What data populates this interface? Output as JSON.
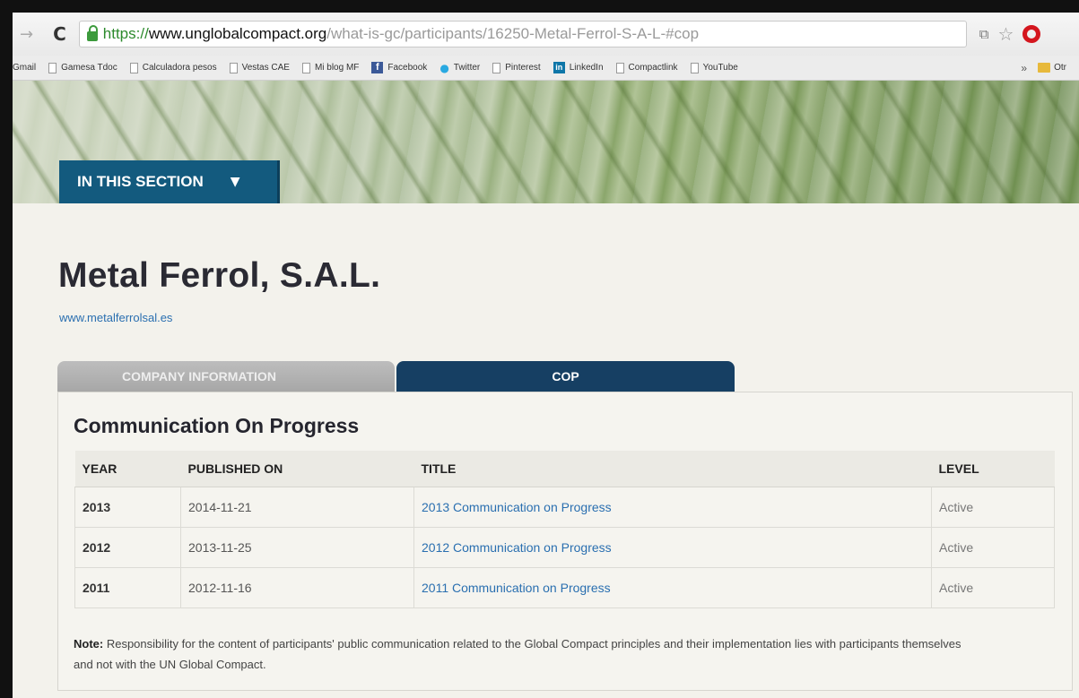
{
  "browser": {
    "url_scheme": "https://",
    "url_host": "www.unglobalcompact.org",
    "url_path": "/what-is-gc/participants/16250-Metal-Ferrol-S-A-L-#cop",
    "bookmarks": [
      "Gmail",
      "Gamesa Tdoc",
      "Calculadora pesos",
      "Vestas CAE",
      "Mi blog MF",
      "Facebook",
      "Twitter",
      "Pinterest",
      "LinkedIn",
      "Compactlink",
      "YouTube"
    ],
    "bookmarks_more": "»",
    "other_bookmarks": "Otr"
  },
  "section_menu": {
    "label": "IN THIS SECTION"
  },
  "company": {
    "name": "Metal Ferrol, S.A.L.",
    "website": "www.metalferrolsal.es"
  },
  "tabs": {
    "info": "COMPANY INFORMATION",
    "cop": "COP"
  },
  "cop": {
    "heading": "Communication On Progress",
    "columns": {
      "year": "YEAR",
      "published": "PUBLISHED ON",
      "title": "TITLE",
      "level": "LEVEL"
    },
    "rows": [
      {
        "year": "2013",
        "published": "2014-11-21",
        "title": "2013 Communication on Progress",
        "level": "Active"
      },
      {
        "year": "2012",
        "published": "2013-11-25",
        "title": "2012 Communication on Progress",
        "level": "Active"
      },
      {
        "year": "2011",
        "published": "2012-11-16",
        "title": "2011 Communication on Progress",
        "level": "Active"
      }
    ],
    "note_label": "Note:",
    "note_text": " Responsibility for the content of participants' public communication related to the Global Compact principles and their implementation lies with participants themselves and not with the UN Global Compact."
  },
  "colors": {
    "accent_button": "#135a7e",
    "active_tab": "#163f63",
    "link": "#2a6fb0"
  }
}
